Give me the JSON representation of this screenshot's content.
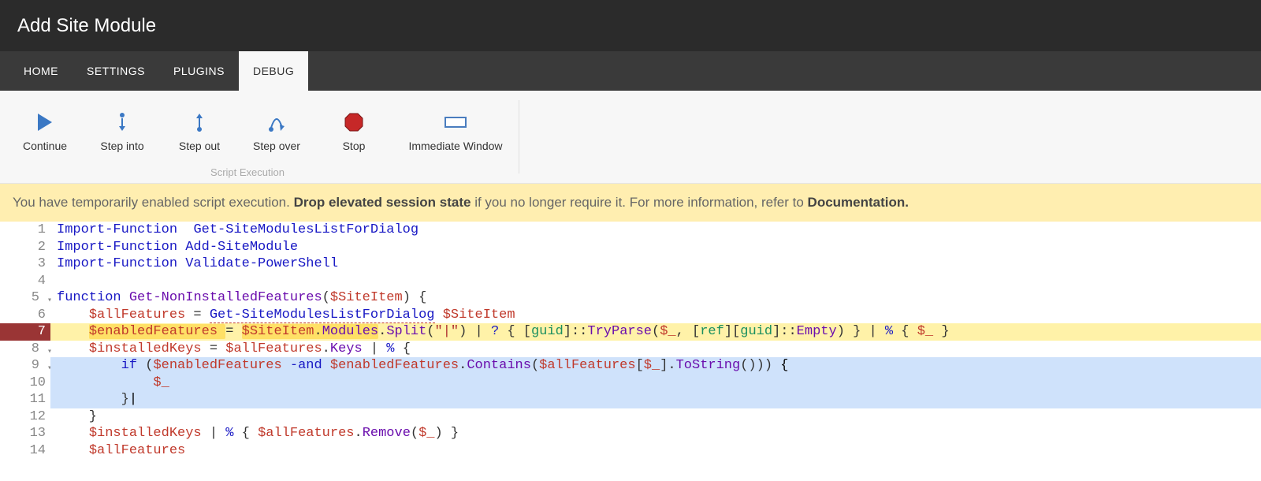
{
  "header": {
    "title": "Add Site Module"
  },
  "tabs": [
    {
      "label": "HOME",
      "active": false
    },
    {
      "label": "SETTINGS",
      "active": false
    },
    {
      "label": "PLUGINS",
      "active": false
    },
    {
      "label": "DEBUG",
      "active": true
    }
  ],
  "toolbar": {
    "items": [
      {
        "id": "continue",
        "label": "Continue",
        "icon": "play-icon"
      },
      {
        "id": "step-into",
        "label": "Step into",
        "icon": "step-into-icon"
      },
      {
        "id": "step-out",
        "label": "Step out",
        "icon": "step-out-icon"
      },
      {
        "id": "step-over",
        "label": "Step over",
        "icon": "step-over-icon"
      },
      {
        "id": "stop",
        "label": "Stop",
        "icon": "stop-icon"
      },
      {
        "id": "immediate",
        "label": "Immediate Window",
        "icon": "window-icon"
      }
    ],
    "group_caption": "Script Execution"
  },
  "banner": {
    "pre": "You have temporarily enabled script execution. ",
    "bold1": "Drop elevated session state",
    "mid": " if you no longer require it. For more information, refer to ",
    "bold2": "Documentation.",
    "post": ""
  },
  "editor": {
    "breakpoint_line": 7,
    "selection_lines": [
      9,
      10,
      11
    ],
    "fold_lines": [
      5,
      8,
      9
    ],
    "lines": [
      {
        "n": 1,
        "tokens": [
          [
            "kw",
            "Import-Function"
          ],
          [
            "pun",
            "  "
          ],
          [
            "kw",
            "Get-SiteModulesListForDialog"
          ]
        ]
      },
      {
        "n": 2,
        "tokens": [
          [
            "kw",
            "Import-Function"
          ],
          [
            "pun",
            " "
          ],
          [
            "kw",
            "Add-SiteModule"
          ]
        ]
      },
      {
        "n": 3,
        "tokens": [
          [
            "kw",
            "Import-Function"
          ],
          [
            "pun",
            " "
          ],
          [
            "kw",
            "Validate-PowerShell"
          ]
        ]
      },
      {
        "n": 4,
        "tokens": []
      },
      {
        "n": 5,
        "tokens": [
          [
            "kw",
            "function"
          ],
          [
            "pun",
            " "
          ],
          [
            "fn",
            "Get-NonInstalledFeatures"
          ],
          [
            "pun",
            "("
          ],
          [
            "var",
            "$SiteItem"
          ],
          [
            "pun",
            ") {"
          ]
        ]
      },
      {
        "n": 6,
        "tokens": [
          [
            "pun",
            "    "
          ],
          [
            "var",
            "$allFeatures"
          ],
          [
            "pun",
            " = "
          ],
          [
            "kw_ru",
            "Get-SiteModulesListForDialog"
          ],
          [
            "pun",
            " "
          ],
          [
            "var",
            "$SiteItem"
          ]
        ]
      },
      {
        "n": 7,
        "tokens": [
          [
            "pun",
            "    "
          ],
          [
            "hl_open",
            ""
          ],
          [
            "var",
            "$enabledFeatures"
          ],
          [
            "pun",
            " "
          ],
          [
            "hl_close",
            ""
          ],
          [
            "pun",
            "= "
          ],
          [
            "hl_open",
            ""
          ],
          [
            "var",
            "$SiteItem"
          ],
          [
            "pun",
            "."
          ],
          [
            "fn",
            "Modules"
          ],
          [
            "hl_close",
            ""
          ],
          [
            "pun",
            "."
          ],
          [
            "fn",
            "Split"
          ],
          [
            "pun",
            "("
          ],
          [
            "str",
            "\"|\""
          ],
          [
            "pun",
            ") | "
          ],
          [
            "kw",
            "?"
          ],
          [
            "pun",
            " { ["
          ],
          [
            "type",
            "guid"
          ],
          [
            "pun",
            "]::"
          ],
          [
            "fn",
            "TryParse"
          ],
          [
            "pun",
            "("
          ],
          [
            "var",
            "$_"
          ],
          [
            "pun",
            ", ["
          ],
          [
            "type",
            "ref"
          ],
          [
            "pun",
            "]["
          ],
          [
            "type",
            "guid"
          ],
          [
            "pun",
            "]::"
          ],
          [
            "fn",
            "Empty"
          ],
          [
            "pun",
            ") } | "
          ],
          [
            "kw",
            "%"
          ],
          [
            "pun",
            " { "
          ],
          [
            "var",
            "$_"
          ],
          [
            "pun",
            " }"
          ]
        ]
      },
      {
        "n": 8,
        "tokens": [
          [
            "pun",
            "    "
          ],
          [
            "var",
            "$installedKeys"
          ],
          [
            "pun",
            " = "
          ],
          [
            "var",
            "$allFeatures"
          ],
          [
            "pun",
            "."
          ],
          [
            "fn",
            "Keys"
          ],
          [
            "pun",
            " | "
          ],
          [
            "kw",
            "%"
          ],
          [
            "pun",
            " {"
          ]
        ]
      },
      {
        "n": 9,
        "tokens": [
          [
            "pun",
            "        "
          ],
          [
            "kw",
            "if"
          ],
          [
            "pun",
            " ("
          ],
          [
            "var",
            "$enabledFeatures"
          ],
          [
            "pun",
            " "
          ],
          [
            "kw",
            "-and"
          ],
          [
            "pun",
            " "
          ],
          [
            "var",
            "$enabledFeatures"
          ],
          [
            "pun",
            "."
          ],
          [
            "fn",
            "Contains"
          ],
          [
            "pun",
            "("
          ],
          [
            "var",
            "$allFeatures"
          ],
          [
            "pun",
            "["
          ],
          [
            "var",
            "$_"
          ],
          [
            "pun",
            "]."
          ],
          [
            "fn",
            "ToString"
          ],
          [
            "pun",
            "())) "
          ],
          [
            "sel_brace",
            "{"
          ]
        ]
      },
      {
        "n": 10,
        "tokens": [
          [
            "pun",
            "            "
          ],
          [
            "var",
            "$_"
          ]
        ]
      },
      {
        "n": 11,
        "tokens": [
          [
            "pun",
            "        }"
          ],
          [
            "cursor",
            "|"
          ]
        ]
      },
      {
        "n": 12,
        "tokens": [
          [
            "pun",
            "    }"
          ]
        ]
      },
      {
        "n": 13,
        "tokens": [
          [
            "pun",
            "    "
          ],
          [
            "var",
            "$installedKeys"
          ],
          [
            "pun",
            " | "
          ],
          [
            "kw",
            "%"
          ],
          [
            "pun",
            " { "
          ],
          [
            "var",
            "$allFeatures"
          ],
          [
            "pun",
            "."
          ],
          [
            "fn",
            "Remove"
          ],
          [
            "pun",
            "("
          ],
          [
            "var",
            "$_"
          ],
          [
            "pun",
            ") }"
          ]
        ]
      },
      {
        "n": 14,
        "tokens": [
          [
            "pun",
            "    "
          ],
          [
            "var",
            "$allFeatures"
          ]
        ]
      }
    ]
  }
}
